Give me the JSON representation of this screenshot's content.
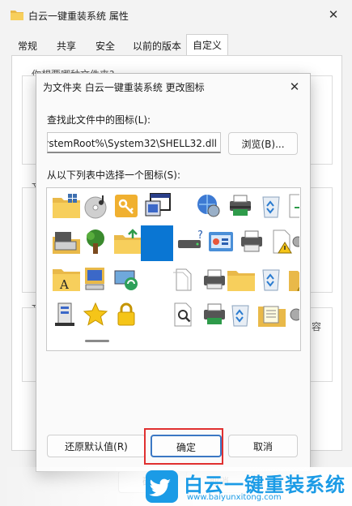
{
  "props_window": {
    "title": "白云一键重装系统 属性",
    "close_glyph": "✕",
    "tabs": [
      {
        "label": "常规"
      },
      {
        "label": "共享"
      },
      {
        "label": "安全"
      },
      {
        "label": "以前的版本"
      },
      {
        "label": "自定义"
      }
    ],
    "active_tab": "自定义",
    "partial_text_a": "你想要哪种文件夹?",
    "partial_text_b": "文",
    "partial_text_c": "文",
    "partial_text_d": "容",
    "ok_label": "确",
    "cancel_label": "取消"
  },
  "dialog": {
    "title": "为文件夹 白云一键重装系统 更改图标",
    "close_glyph": "✕",
    "find_label": "查找此文件中的图标(L):",
    "path_value": "SystemRoot%\\System32\\SHELL32.dll",
    "browse_label": "浏览(B)...",
    "select_label": "从以下列表中选择一个图标(S):",
    "icons": [
      "folder-grid-icon",
      "music-cd-icon",
      "key-icon",
      "program-window-icon",
      "network-globe-icon",
      "printer-icon",
      "recycle-bin-icon",
      "partial-green-icon",
      "scanner-icon",
      "tree-icon",
      "folder-upload-icon",
      "blank-icon-selected",
      "drive-question-icon",
      "control-panel-icon",
      "printer-icon",
      "document-warning-icon",
      "gear-partial-icon",
      "folder-font-icon",
      "computer-folder-icon",
      "monitor-sync-icon",
      "blank-icon",
      "documents-icon",
      "printer-folder-icon",
      "recycle-bin-icon",
      "folder-warning-icon",
      "document-partial-icon",
      "server-icon",
      "star-icon",
      "lock-icon",
      "blank-icon",
      "search-document-icon",
      "green-printer-icon",
      "recycle-bin-icon",
      "folder-notes-icon",
      "gear-partial-icon"
    ],
    "restore_label": "还原默认值(R)",
    "ok_label": "确定",
    "cancel_label": "取消"
  },
  "watermark": {
    "brand": "白云一键重装系统",
    "url": "www.baiyunxitong.com"
  },
  "colors": {
    "selection": "#0a76d3",
    "highlight": "#e03030",
    "brand": "#1b9be6"
  }
}
